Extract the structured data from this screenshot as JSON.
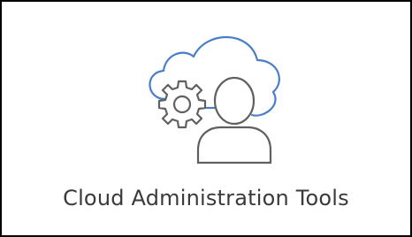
{
  "tile": {
    "label": "Cloud Administration Tools",
    "icon": "cloud-admin-icon"
  },
  "colors": {
    "cloud": "#4a7fc7",
    "gear_and_user": "#606060",
    "border": "#000000",
    "label": "#3a3a3a"
  }
}
